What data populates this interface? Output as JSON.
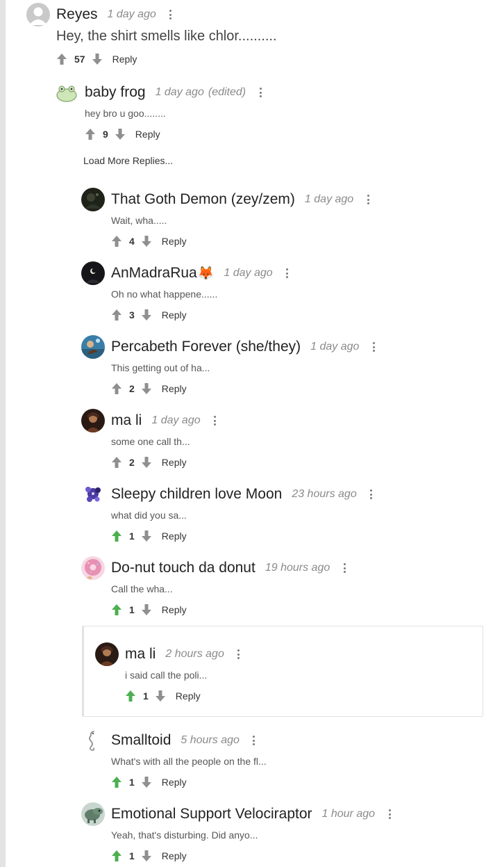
{
  "thread": {
    "load_more_label": "Load More Replies...",
    "upvote_color": "#4caf50",
    "vote_color": "#8f8f8f",
    "comments": [
      {
        "name": "Reyes",
        "time": "1 day ago",
        "edited": "",
        "text": "Hey, the shirt smells like chlor..........",
        "votes": "57",
        "reply": "Reply",
        "upvoted": false,
        "avatar": "default-avatar"
      },
      {
        "name": "baby frog",
        "time": "1 day ago",
        "edited": "(edited)",
        "text": "hey bro u goo........",
        "votes": "9",
        "reply": "Reply",
        "upvoted": false,
        "avatar": "frog-avatar"
      },
      {
        "name": "That Goth Demon (zey/zem)",
        "time": "1 day ago",
        "edited": "",
        "text": "Wait, wha.....",
        "votes": "4",
        "reply": "Reply",
        "upvoted": false,
        "avatar": "dark-avatar"
      },
      {
        "name": "AnMadraRua",
        "emoji": "🦊",
        "time": "1 day ago",
        "edited": "",
        "text": "Oh no what happene......",
        "votes": "3",
        "reply": "Reply",
        "upvoted": false,
        "avatar": "moon-avatar"
      },
      {
        "name": "Percabeth Forever (she/they)",
        "time": "1 day ago",
        "edited": "",
        "text": "This getting out of ha...",
        "votes": "2",
        "reply": "Reply",
        "upvoted": false,
        "avatar": "ocean-avatar"
      },
      {
        "name": "ma li",
        "time": "1 day ago",
        "edited": "",
        "text": "some one call th...",
        "votes": "2",
        "reply": "Reply",
        "upvoted": false,
        "avatar": "character-avatar"
      },
      {
        "name": "Sleepy children love Moon",
        "time": "23 hours ago",
        "edited": "",
        "text": "what did you sa...",
        "votes": "1",
        "reply": "Reply",
        "upvoted": true,
        "avatar": "purple-avatar"
      },
      {
        "name": "Do-nut touch da donut",
        "time": "19 hours ago",
        "edited": "",
        "text": "Call the wha...",
        "votes": "1",
        "reply": "Reply",
        "upvoted": true,
        "avatar": "donut-avatar"
      },
      {
        "name": "ma li",
        "time": "2 hours ago",
        "edited": "",
        "text": "i said call the poli...",
        "votes": "1",
        "reply": "Reply",
        "upvoted": true,
        "avatar": "character-avatar"
      },
      {
        "name": "Smalltoid",
        "time": "5 hours ago",
        "edited": "",
        "text": "What's with all the people on the fl...",
        "votes": "1",
        "reply": "Reply",
        "upvoted": true,
        "avatar": "seahorse-avatar"
      },
      {
        "name": "Emotional Support Velociraptor",
        "time": "1 hour ago",
        "edited": "",
        "text": "Yeah, that's disturbing. Did anyo...",
        "votes": "1",
        "reply": "Reply",
        "upvoted": true,
        "avatar": "dino-avatar"
      }
    ]
  }
}
